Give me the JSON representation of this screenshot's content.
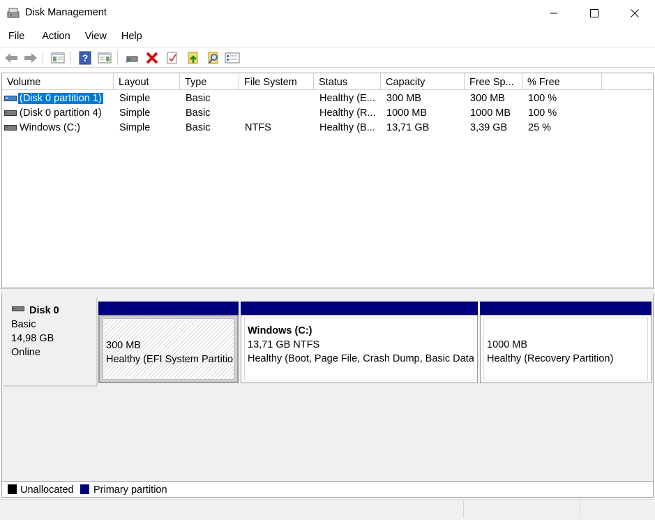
{
  "window": {
    "title": "Disk Management",
    "minimize_icon": "minimize-icon",
    "maximize_icon": "maximize-icon",
    "close_icon": "close-icon"
  },
  "menu": [
    "File",
    "Action",
    "View",
    "Help"
  ],
  "toolbar": {
    "icons": [
      "back-arrow-icon",
      "forward-arrow-icon",
      "show-hide-console-tree-icon",
      "help-icon",
      "show-hide-action-pane-icon",
      "connect-disk-icon",
      "delete-icon",
      "properties-icon",
      "export-list-icon",
      "find-icon",
      "refresh-icon"
    ]
  },
  "volumes": {
    "columns": [
      "Volume",
      "Layout",
      "Type",
      "File System",
      "Status",
      "Capacity",
      "Free Sp...",
      "% Free"
    ],
    "rows": [
      [
        "(Disk 0 partition 1)",
        "Simple",
        "Basic",
        "",
        "Healthy (E...",
        "300 MB",
        "300 MB",
        "100 %"
      ],
      [
        "(Disk 0 partition 4)",
        "Simple",
        "Basic",
        "",
        "Healthy (R...",
        "1000 MB",
        "1000 MB",
        "100 %"
      ],
      [
        "Windows (C:)",
        "Simple",
        "Basic",
        "NTFS",
        "Healthy (B...",
        "13,71 GB",
        "3,39 GB",
        "25 %"
      ]
    ],
    "selected_row": 0
  },
  "disk": {
    "name": "Disk 0",
    "type": "Basic",
    "size": "14,98 GB",
    "state": "Online",
    "partitions": [
      {
        "title": "",
        "size": "300 MB",
        "status": "Healthy (EFI System Partitio"
      },
      {
        "title": "Windows  (C:)",
        "size": "13,71 GB NTFS",
        "status": "Healthy (Boot, Page File, Crash Dump, Basic Data"
      },
      {
        "title": "",
        "size": "1000 MB",
        "status": "Healthy (Recovery Partition)"
      }
    ]
  },
  "legend": [
    {
      "label": "Unallocated",
      "color": "#000000"
    },
    {
      "label": "Primary partition",
      "color": "#00007f"
    }
  ],
  "colors": {
    "primary_partition_bar": "#00007f",
    "selection": "#0078d7"
  }
}
